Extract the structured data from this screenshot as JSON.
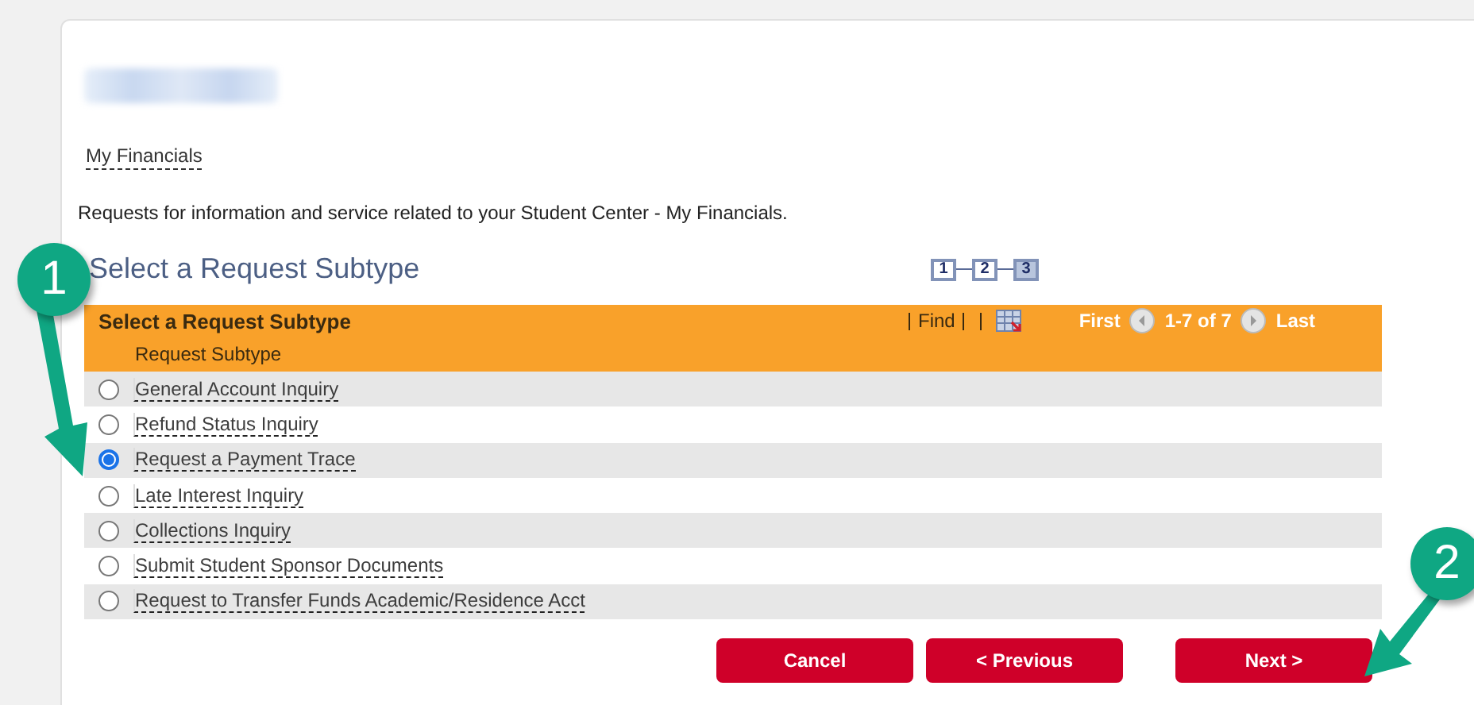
{
  "breadcrumb": {
    "label": "My Financials"
  },
  "description": "Requests for information and service related to your Student Center - My Financials.",
  "heading": "Select a Request Subtype",
  "steps": [
    {
      "label": "1",
      "selected": false
    },
    {
      "label": "2",
      "selected": false
    },
    {
      "label": "3",
      "selected": true
    }
  ],
  "grid": {
    "title": "Select a Request Subtype",
    "find": "Find",
    "first": "First",
    "range": "1-7 of 7",
    "last": "Last",
    "column": "Request Subtype",
    "rows": [
      {
        "label": "General Account Inquiry",
        "selected": false
      },
      {
        "label": "Refund Status Inquiry",
        "selected": false
      },
      {
        "label": "Request a Payment Trace",
        "selected": true
      },
      {
        "label": "Late Interest Inquiry",
        "selected": false
      },
      {
        "label": "Collections Inquiry",
        "selected": false
      },
      {
        "label": "Submit Student Sponsor Documents",
        "selected": false
      },
      {
        "label": "Request to Transfer Funds Academic/Residence Acct",
        "selected": false
      }
    ]
  },
  "buttons": [
    "Cancel",
    "< Previous",
    "Next >"
  ],
  "callouts": [
    "1",
    "2"
  ]
}
